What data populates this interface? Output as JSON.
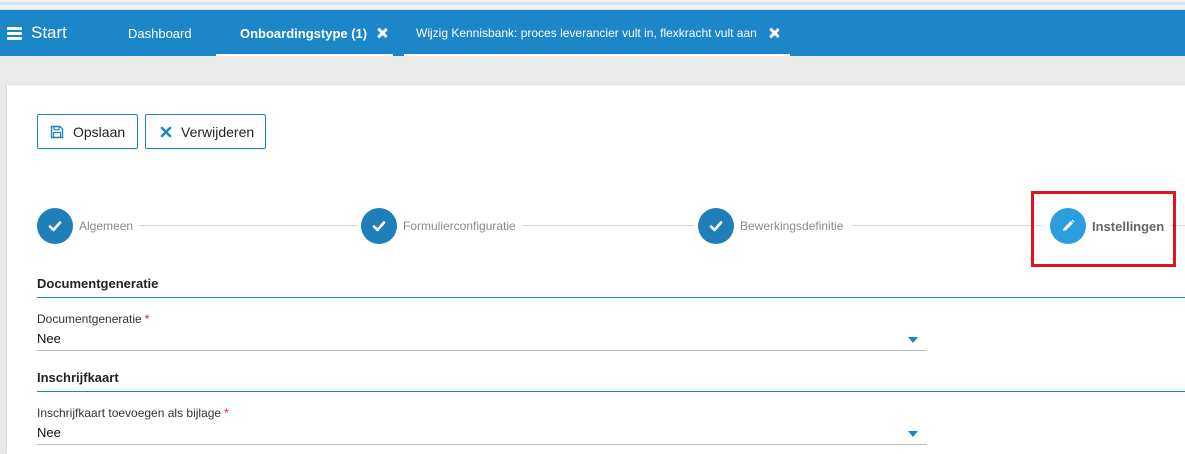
{
  "navbar": {
    "start_label": "Start",
    "tabs": [
      {
        "label": "Dashboard"
      },
      {
        "label": "Onboardingstype (1)"
      },
      {
        "label": "Wijzig Kennisbank: proces leverancier vult in, flexkracht vult aan"
      }
    ]
  },
  "toolbar": {
    "save_label": "Opslaan",
    "delete_label": "Verwijderen"
  },
  "stepper": {
    "steps": [
      {
        "label": "Algemeen",
        "icon": "check-icon",
        "state": "done"
      },
      {
        "label": "Formulierconfiguratie",
        "icon": "check-icon",
        "state": "done"
      },
      {
        "label": "Bewerkingsdefinitie",
        "icon": "check-icon",
        "state": "done"
      },
      {
        "label": "Instellingen",
        "icon": "pencil-icon",
        "state": "current"
      }
    ]
  },
  "sections": [
    {
      "title": "Documentgeneratie",
      "field": {
        "label": "Documentgeneratie",
        "required": "*",
        "value": "Nee"
      }
    },
    {
      "title": "Inschrijfkaart",
      "field": {
        "label": "Inschrijfkaart toevoegen als bijlage",
        "required": "*",
        "value": "Nee"
      }
    }
  ],
  "colors": {
    "primary": "#1b87c9",
    "step_done": "#1f7fb9",
    "step_current": "#2b9ee0",
    "highlight": "#e0141e",
    "required": "#e0141e"
  }
}
